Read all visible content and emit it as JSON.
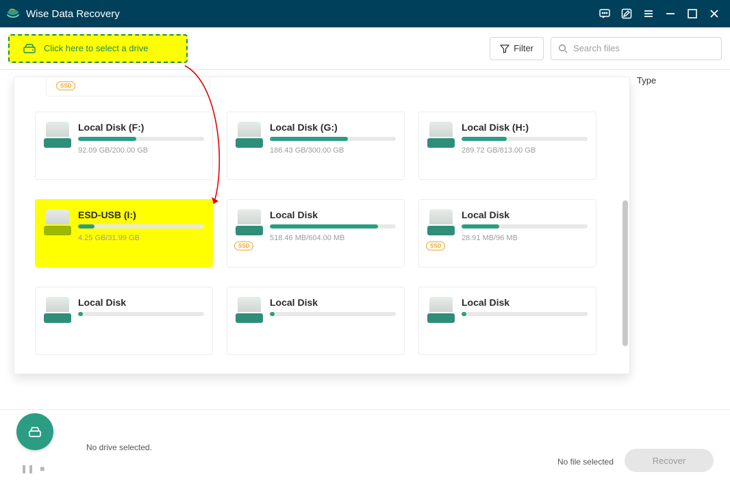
{
  "app": {
    "title": "Wise Data Recovery"
  },
  "toolbar": {
    "select_drive_label": "Click here to select a drive",
    "filter_label": "Filter",
    "search_placeholder": "Search files"
  },
  "columns": {
    "type": "Type"
  },
  "drives": [
    {
      "name": "Local Disk (F:)",
      "size": "92.09 GB/200.00 GB",
      "pct": 46,
      "kind": "hdd",
      "highlight": false
    },
    {
      "name": "Local Disk (G:)",
      "size": "186.43 GB/300.00 GB",
      "pct": 62,
      "kind": "hdd",
      "highlight": false
    },
    {
      "name": "Local Disk (H:)",
      "size": "289.72 GB/813.00 GB",
      "pct": 36,
      "kind": "hdd",
      "highlight": false
    },
    {
      "name": "ESD-USB (I:)",
      "size": "4.25 GB/31.99 GB",
      "pct": 13,
      "kind": "usb",
      "highlight": true
    },
    {
      "name": "Local Disk",
      "size": "518.46 MB/604.00 MB",
      "pct": 86,
      "kind": "ssd",
      "highlight": false
    },
    {
      "name": "Local Disk",
      "size": "28.91 MB/96 MB",
      "pct": 30,
      "kind": "ssd",
      "highlight": false
    },
    {
      "name": "Local Disk",
      "size": "",
      "pct": 4,
      "kind": "hdd",
      "highlight": false
    },
    {
      "name": "Local Disk",
      "size": "",
      "pct": 4,
      "kind": "hdd",
      "highlight": false
    },
    {
      "name": "Local Disk",
      "size": "",
      "pct": 4,
      "kind": "hdd",
      "highlight": false
    }
  ],
  "footer": {
    "no_drive": "No drive selected.",
    "no_file": "No file selected",
    "recover": "Recover"
  },
  "badge": {
    "ssd": "SSD"
  }
}
